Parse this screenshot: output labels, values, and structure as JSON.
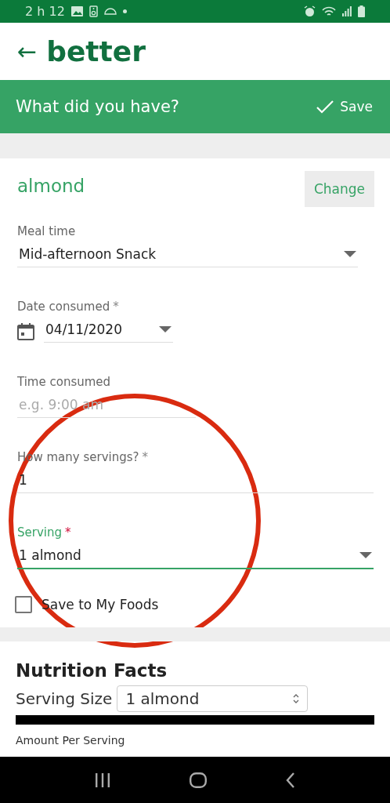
{
  "status_bar": {
    "time": "2 h 12"
  },
  "app_bar": {
    "back": "←",
    "title": "better"
  },
  "action_bar": {
    "title": "What did you have?",
    "save": "Save"
  },
  "food": {
    "name": "almond",
    "change": "Change"
  },
  "fields": [
    {
      "kind": "select",
      "label": "Meal time",
      "value": "Mid-afternoon Snack",
      "focused": false
    },
    {
      "kind": "date",
      "label": "Date consumed",
      "required_mark": "*",
      "value": "04/11/2020",
      "focused": false
    },
    {
      "kind": "text",
      "label": "Time consumed",
      "placeholder": "e.g. 9:00 am",
      "focused": false
    },
    {
      "kind": "text",
      "label": "How many servings?",
      "required_mark": "*",
      "value": "1",
      "focused": false
    },
    {
      "kind": "select",
      "label": "Serving",
      "required_mark": "*",
      "value": "1 almond",
      "focused": true
    }
  ],
  "save_to_my_foods": {
    "label": "Save to My Foods",
    "checked": false
  },
  "nutrition": {
    "title": "Nutrition Facts",
    "serving_size_label": "Serving Size",
    "serving_size": "1 almond",
    "amount_label": "Amount Per Serving"
  }
}
